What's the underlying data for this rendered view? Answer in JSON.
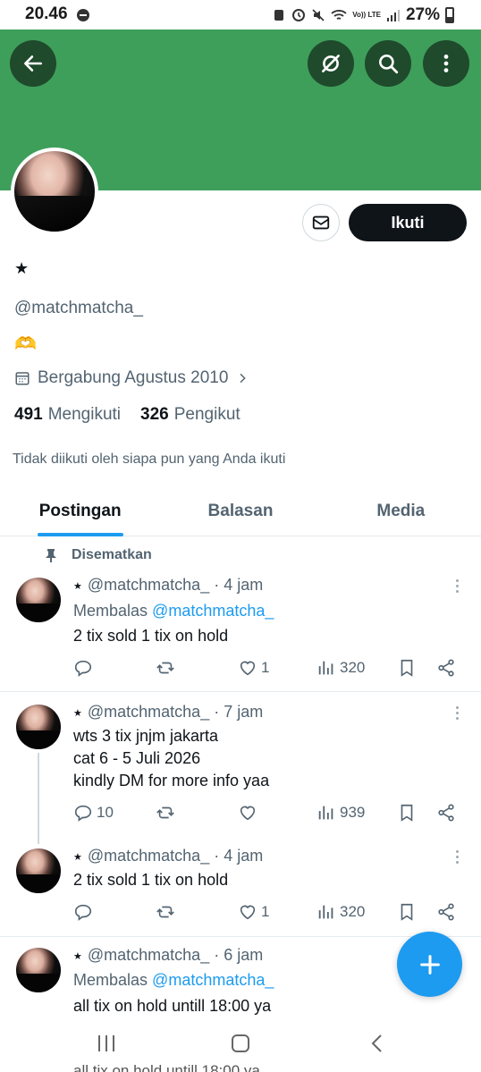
{
  "status_bar": {
    "time": "20.46",
    "network_label": "Vo)) LTE",
    "battery": "27%"
  },
  "profile": {
    "display_name": "★",
    "handle": "@matchmatcha_",
    "bio": "🫶",
    "joined": "Bergabung Agustus 2010",
    "following_count": "491",
    "following_label": "Mengikuti",
    "followers_count": "326",
    "followers_label": "Pengikut",
    "follow_button": "Ikuti",
    "not_followed_note": "Tidak diikuti oleh siapa pun yang Anda ikuti"
  },
  "tabs": [
    {
      "label": "Postingan",
      "active": true
    },
    {
      "label": "Balasan",
      "active": false
    },
    {
      "label": "Media",
      "active": false
    }
  ],
  "pinned_label": "Disematkan",
  "posts": [
    {
      "author": "@matchmatcha_",
      "time": "4 jam",
      "reply_prefix": "Membalas",
      "reply_to": "@matchmatcha_",
      "text": [
        "2 tix sold 1 tix on hold"
      ],
      "replies": "",
      "likes": "1",
      "views": "320"
    },
    {
      "author": "@matchmatcha_",
      "time": "7 jam",
      "text": [
        "wts 3 tix jnjm jakarta",
        "cat 6 - 5 Juli 2026",
        "kindly DM for more info yaa"
      ],
      "replies": "10",
      "likes": "",
      "views": "939"
    },
    {
      "author": "@matchmatcha_",
      "time": "4 jam",
      "text": [
        "2 tix sold 1 tix on hold"
      ],
      "replies": "",
      "likes": "1",
      "views": "320"
    },
    {
      "author": "@matchmatcha_",
      "time": "6 jam",
      "reply_prefix": "Membalas",
      "reply_to": "@matchmatcha_",
      "text": [
        "all tix on hold untill 18:00 ya"
      ]
    }
  ],
  "ghost_text": "all tix on hold untill 18:00 ya",
  "colors": {
    "banner": "#3e9f5a",
    "accent": "#1d9bf0",
    "follow_button": "#0f1419"
  }
}
